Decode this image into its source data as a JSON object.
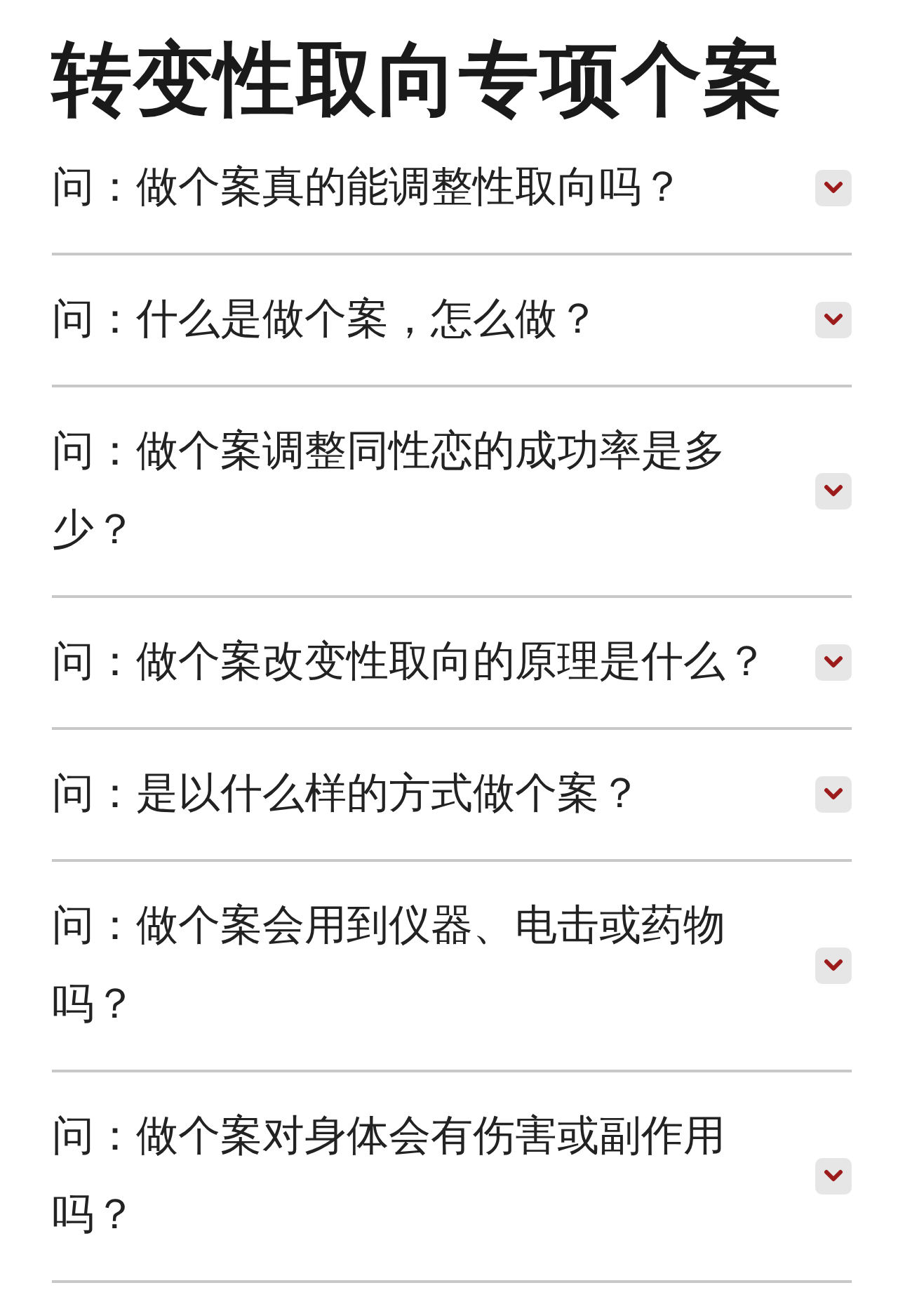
{
  "title": "转变性取向专项个案",
  "questions": [
    {
      "text": "问：做个案真的能调整性取向吗？",
      "expanded": false
    },
    {
      "text": "问：什么是做个案，怎么做？",
      "expanded": false
    },
    {
      "text": "问：做个案调整同性恋的成功率是多少？",
      "expanded": false
    },
    {
      "text": "问：做个案改变性取向的原理是什么？",
      "expanded": false
    },
    {
      "text": "问：是以什么样的方式做个案？",
      "expanded": false
    },
    {
      "text": "问：做个案会用到仪器、电击或药物吗？",
      "expanded": false
    },
    {
      "text": "问：做个案对身体会有伤害或副作用吗？",
      "expanded": false
    }
  ]
}
